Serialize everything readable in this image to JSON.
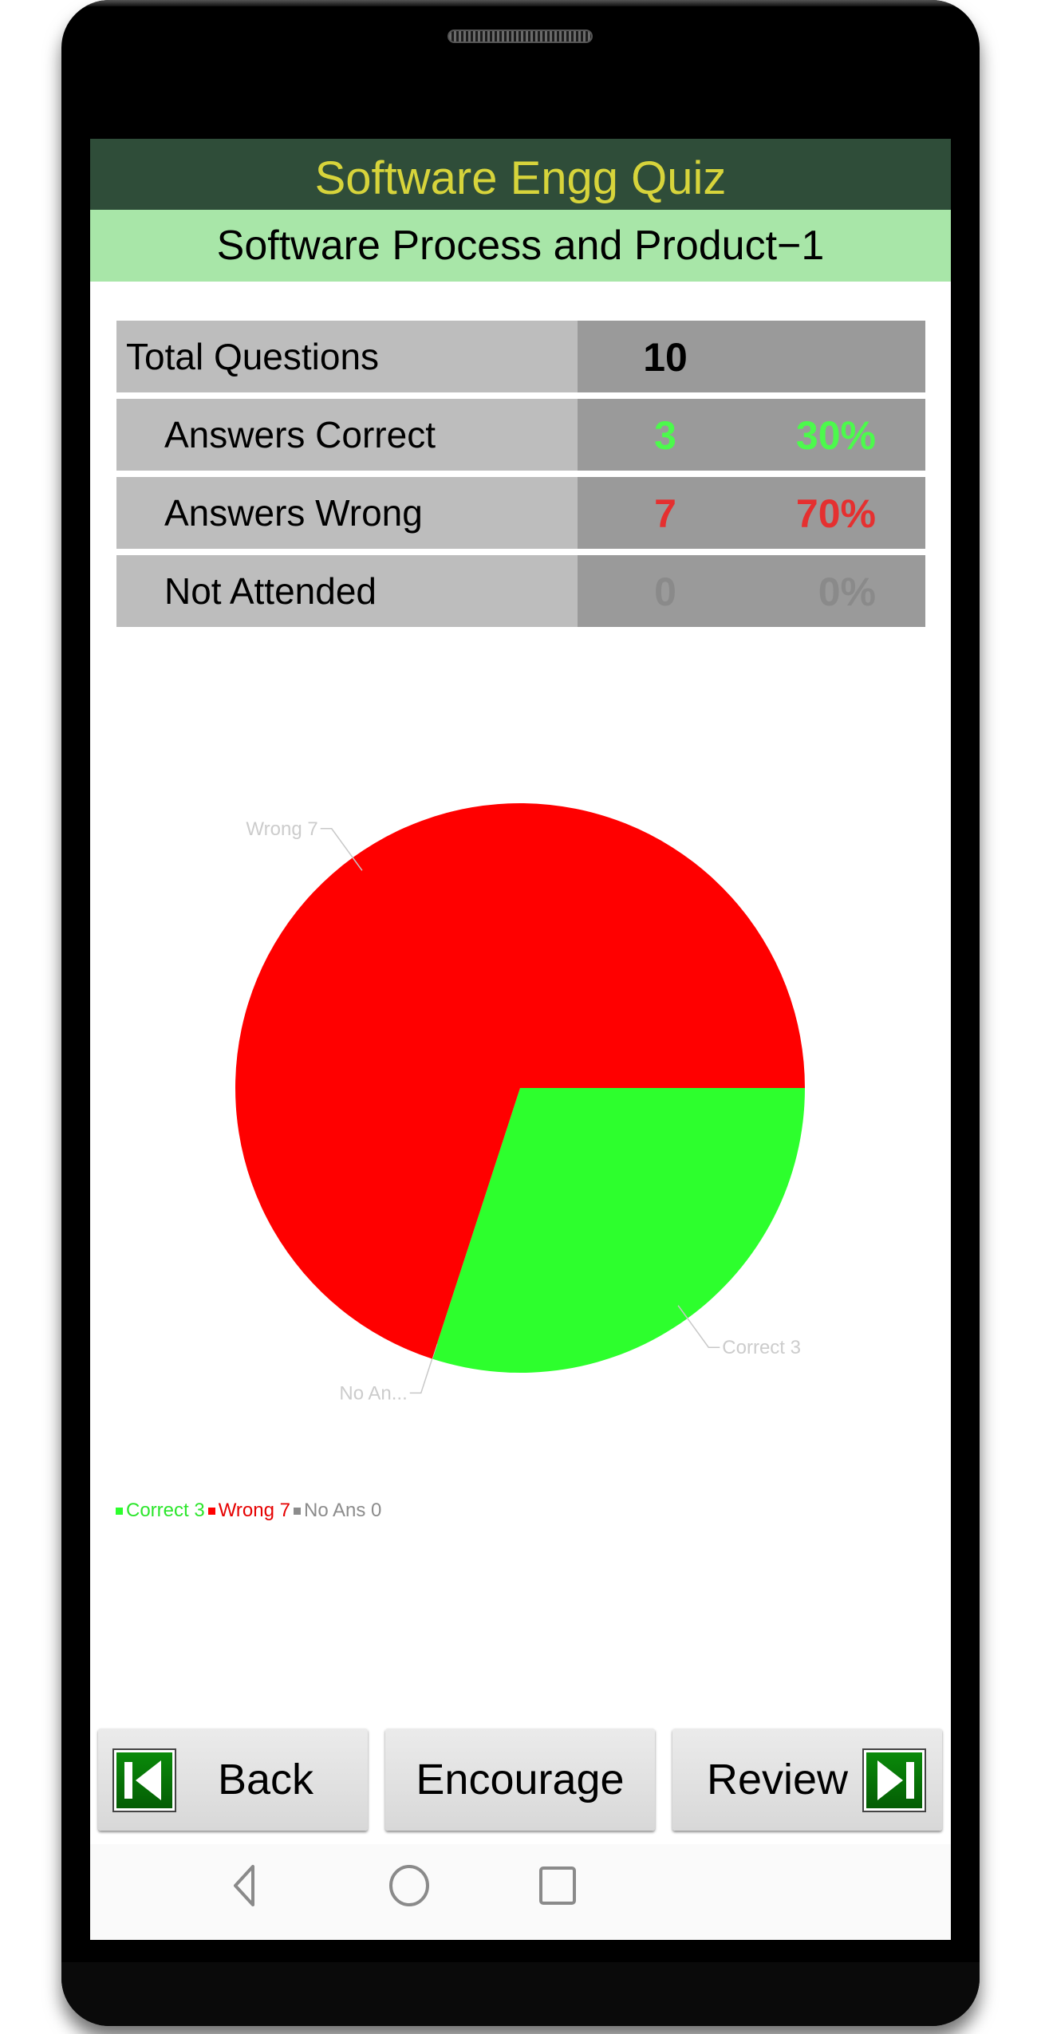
{
  "app": {
    "title": "Software Engg Quiz",
    "subtitle": "Software Process and Product−1"
  },
  "stats": {
    "rows": [
      {
        "label": "Total Questions",
        "count": "10",
        "percent": "",
        "color": "#000000"
      },
      {
        "label": "Answers Correct",
        "count": "3",
        "percent": "30%",
        "color": "#4cfa4c"
      },
      {
        "label": "Answers Wrong",
        "count": "7",
        "percent": "70%",
        "color": "#e53030"
      },
      {
        "label": "Not Attended",
        "count": "0",
        "percent": "0%",
        "color": "#8a8a8a"
      }
    ]
  },
  "chart_data": {
    "type": "pie",
    "title": "",
    "slices": [
      {
        "name": "Correct",
        "value": 3,
        "label": "Correct 3",
        "color": "#2dff2d"
      },
      {
        "name": "No Ans",
        "value": 0,
        "label": "No An...",
        "color": "#8c8c8c"
      },
      {
        "name": "Wrong",
        "value": 7,
        "label": "Wrong 7",
        "color": "#ff0000"
      }
    ],
    "start_angle_deg": 0,
    "direction": "clockwise",
    "legend": {
      "placement": "bottom-left",
      "entries": [
        {
          "label": "Correct 3",
          "color": "#2dff2d",
          "text_color": "#2ce62c"
        },
        {
          "label": "Wrong 7",
          "color": "#ff0000",
          "text_color": "#e60000"
        },
        {
          "label": "No Ans 0",
          "color": "#8c8c8c",
          "text_color": "#8c8c8c"
        }
      ]
    }
  },
  "buttons": {
    "back": "Back",
    "encourage": "Encourage",
    "review": "Review"
  },
  "icons": {
    "back": "skip-back-icon",
    "review": "skip-forward-icon",
    "nav_back": "triangle-back-icon",
    "nav_home": "circle-home-icon",
    "nav_recents": "square-recents-icon"
  }
}
